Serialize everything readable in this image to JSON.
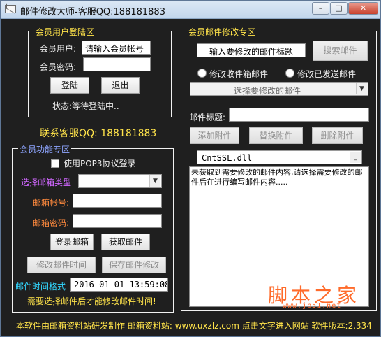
{
  "window": {
    "title": "邮件修改大师-客服QQ:188181883",
    "buttons": {
      "minimize": "–",
      "maximize": "□",
      "close": "✕"
    }
  },
  "login": {
    "group_title": "会员用户登陆区",
    "user_label": "会员用户:",
    "user_value": "请输入会员帐号",
    "password_label": "会员密码:",
    "password_value": "",
    "login_button": "登陆",
    "logout_button": "退出",
    "status": "状态:等待登陆中.."
  },
  "contact": "联系客服QQ: 188181883",
  "features": {
    "group_title": "会员功能专区",
    "pop3_label": "使用POP3协议登录",
    "pop3_checked": false,
    "mailbox_type_label": "选择邮箱类型",
    "mailbox_type_value": "",
    "account_label": "邮箱帐号:",
    "account_value": "",
    "password_label": "邮箱密码:",
    "password_value": "",
    "login_mailbox_button": "登录邮箱",
    "fetch_mail_button": "获取邮件",
    "modify_time_button": "修改邮件时间",
    "save_modify_button": "保存邮件修改",
    "time_format_label": "邮件时间格式",
    "time_value": "2016-01-01 13:59:08",
    "notice": "需要选择邮件后才能修改邮件时间!"
  },
  "edit": {
    "group_title": "会员邮件修改专区",
    "search_placeholder": "输入要修改的邮件标题",
    "search_button": "搜索邮件",
    "radio_inbox": "修改收件箱邮件",
    "radio_sent": "修改已发送邮件",
    "select_mail": "选择要修改的邮件",
    "subject_label": "邮件标题:",
    "subject_value": "",
    "add_attachment": "添加附件",
    "replace_attachment": "替换附件",
    "delete_attachment": "删除附件",
    "attachment_value": "CntSSL.dll",
    "message": "未获取到需要修改的邮件内容,请选择需要修改的邮件后在进行编写邮件内容....."
  },
  "footer": "本软件由邮箱资料站研发制作 邮箱资料站: www.uxzlz.com 点击文字进入网站 软件版本:2.334",
  "watermark": {
    "logo": "脚本之家",
    "url": "www.jb51.net"
  },
  "colors": {
    "background": "#1f1f1f",
    "yellow": "#ffe34a",
    "orange": "#ff8a3d",
    "cyan": "#32d7ff",
    "purple": "#d067ff",
    "blue": "#8ea5ff"
  },
  "icons": [
    "app-envelope-icon",
    "minimize-icon",
    "maximize-icon",
    "close-icon",
    "dropdown-arrow-icon",
    "radio-icon",
    "checkbox-icon"
  ]
}
